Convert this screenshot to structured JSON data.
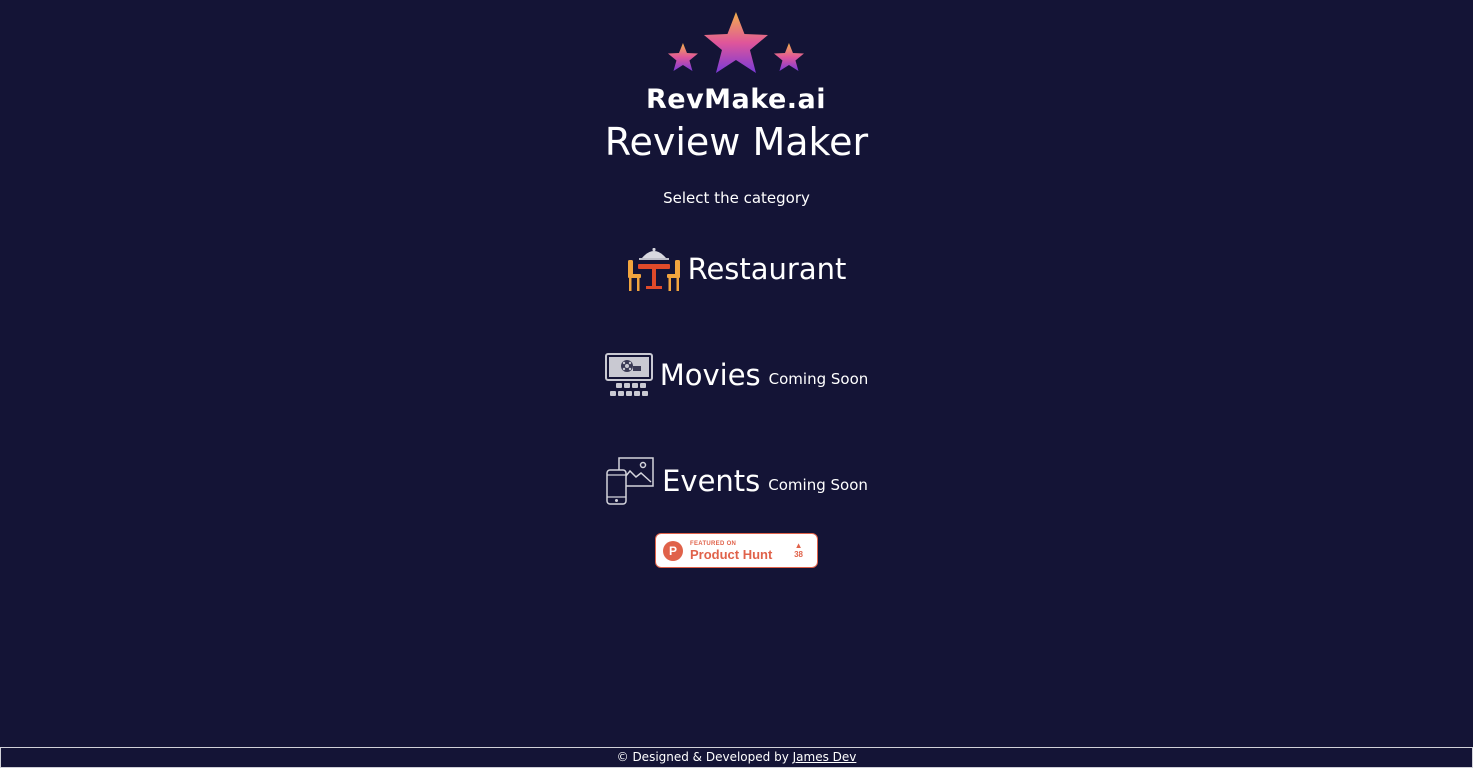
{
  "brand": {
    "logo_text": "RevMake.ai"
  },
  "header": {
    "title": "Review Maker",
    "subtitle": "Select the category"
  },
  "categories": [
    {
      "label": "Restaurant",
      "badge": "",
      "icon": "restaurant-table-icon"
    },
    {
      "label": "Movies",
      "badge": "Coming Soon",
      "icon": "cinema-screen-icon"
    },
    {
      "label": "Events",
      "badge": "Coming Soon",
      "icon": "events-phone-image-icon"
    }
  ],
  "product_hunt": {
    "featured_on": "FEATURED ON",
    "name": "Product Hunt",
    "arrow": "▲",
    "votes": "38",
    "logo_letter": "P"
  },
  "footer": {
    "text": "© Designed & Developed by ",
    "author_link": "James Dev"
  },
  "colors": {
    "background": "#141436",
    "accent": "#e0624a",
    "text": "#ffffff"
  }
}
